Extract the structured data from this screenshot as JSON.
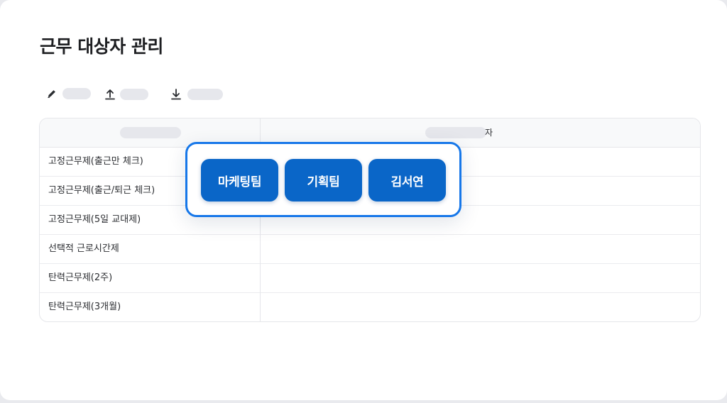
{
  "page": {
    "title": "근무 대상자 관리"
  },
  "toolbar": {
    "items": [
      {
        "icon": "pencil-icon"
      },
      {
        "icon": "upload-icon"
      },
      {
        "icon": "download-icon"
      }
    ]
  },
  "table": {
    "header": {
      "col2_tail": "자"
    },
    "rows": [
      {
        "label": "고정근무제(출근만 체크)"
      },
      {
        "label": "고정근무제(출근/퇴근 체크)"
      },
      {
        "label": "고정근무제(5일 교대제)"
      },
      {
        "label": "선택적 근로시간제"
      },
      {
        "label": "탄력근무제(2주)"
      },
      {
        "label": "탄력근무제(3개월)"
      }
    ]
  },
  "popover": {
    "options": [
      "마케팅팀",
      "기획팀",
      "김서연"
    ]
  },
  "colors": {
    "accent": "#0a66c8",
    "popover_border": "#1677e9"
  }
}
